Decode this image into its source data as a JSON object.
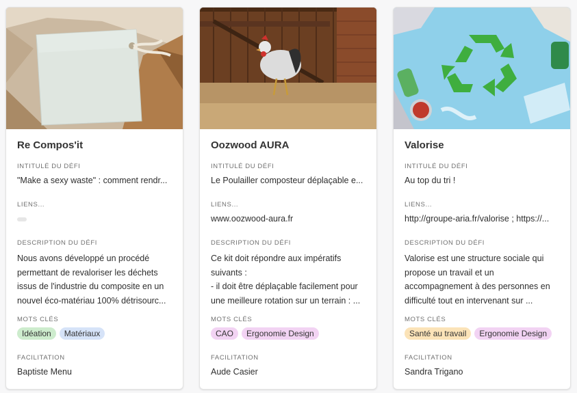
{
  "labels": {
    "challenge": "INTITULÉ DU DÉFI",
    "links": "LIENS...",
    "description": "DESCRIPTION DU DÉFI",
    "keywords": "MOTS CLÉS",
    "facilitation": "FACILITATION"
  },
  "cards": [
    {
      "title": "Re Compos'it",
      "challenge": "\"Make a sexy waste\" : comment rendr...",
      "links": "",
      "description": "Nous avons développé un procédé permettant de revaloriser les déchets issus de l'industrie du composite en un nouvel éco-matériau 100% détrisourc...",
      "keywords": [
        {
          "label": "Idéation",
          "color": "#cdeccd"
        },
        {
          "label": "Matériaux",
          "color": "#d6e3f8"
        }
      ],
      "facilitator": "Baptiste Menu",
      "image": "paper-tag-in-box"
    },
    {
      "title": "Oozwood AURA",
      "challenge": "Le Poulailler composteur déplaçable e...",
      "links": "www.oozwood-aura.fr",
      "description": "Ce kit doit répondre aux impératifs suivants :\n- il doit être déplaçable facilement pour une meilleure rotation sur un terrain : ...",
      "keywords": [
        {
          "label": "CAO",
          "color": "#f2d3f3"
        },
        {
          "label": "Ergonomie Design",
          "color": "#f2d3f3"
        }
      ],
      "facilitator": "Aude Casier",
      "image": "rooster-barn"
    },
    {
      "title": "Valorise",
      "challenge": "Au top du tri !",
      "links": "http://groupe-aria.fr/valorise ; https://...",
      "description": "Valorise est une structure sociale qui propose un travail et un accompagnement à des personnes en difficulté tout en intervenant sur ...",
      "keywords": [
        {
          "label": "Santé au travail",
          "color": "#fbe3b8"
        },
        {
          "label": "Ergonomie Design",
          "color": "#f2d3f3"
        }
      ],
      "facilitator": "Sandra Trigano",
      "image": "recycling-symbol"
    }
  ]
}
